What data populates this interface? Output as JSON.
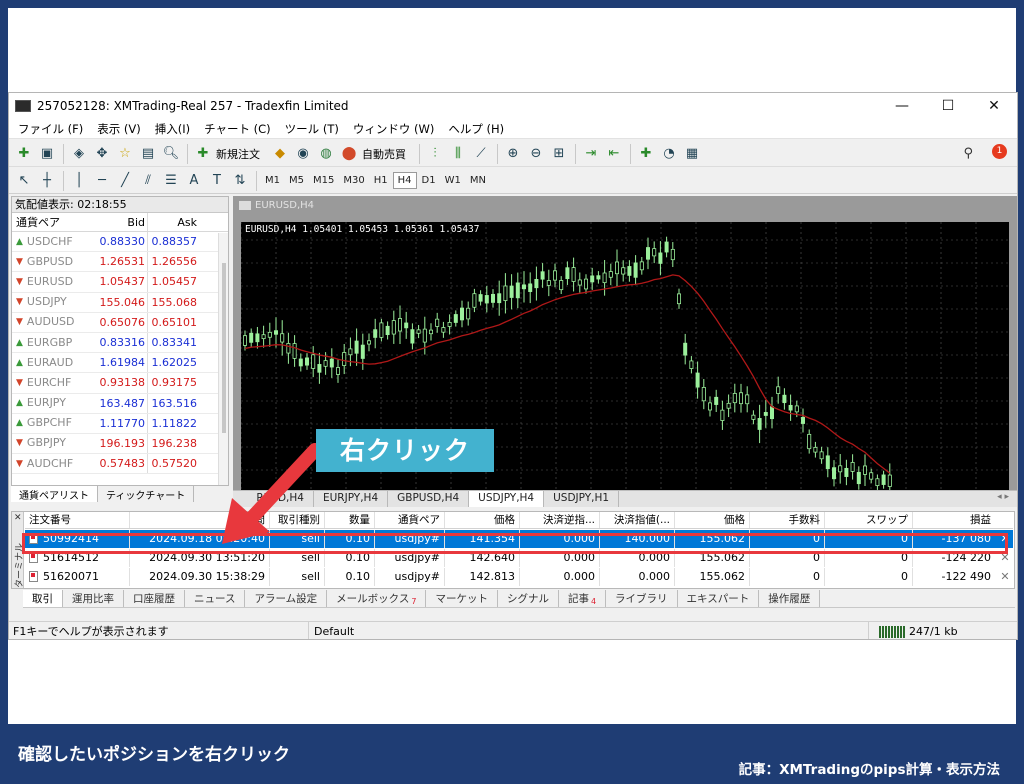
{
  "window": {
    "title": "257052128: XMTrading-Real 257 - Tradexfin Limited",
    "minimize": "—",
    "maximize": "☐",
    "close": "✕"
  },
  "menu": [
    "ファイル (F)",
    "表示 (V)",
    "挿入(I)",
    "チャート (C)",
    "ツール (T)",
    "ウィンドウ (W)",
    "ヘルプ (H)"
  ],
  "toolbar": {
    "new_order": "新規注文",
    "auto_trade": "自動売買",
    "notification_count": "1",
    "timeframes": [
      "M1",
      "M5",
      "M15",
      "M30",
      "H1",
      "H4",
      "D1",
      "W1",
      "MN"
    ],
    "active_timeframe": "H4"
  },
  "market_watch": {
    "header": "気配値表示: 02:18:55",
    "col_symbol": "通貨ペア",
    "col_bid": "Bid",
    "col_ask": "Ask",
    "rows": [
      {
        "symbol": "USDCHF",
        "bid": "0.88330",
        "ask": "0.88357",
        "dir": "up"
      },
      {
        "symbol": "GBPUSD",
        "bid": "1.26531",
        "ask": "1.26556",
        "dir": "down"
      },
      {
        "symbol": "EURUSD",
        "bid": "1.05437",
        "ask": "1.05457",
        "dir": "down"
      },
      {
        "symbol": "USDJPY",
        "bid": "155.046",
        "ask": "155.068",
        "dir": "down"
      },
      {
        "symbol": "AUDUSD",
        "bid": "0.65076",
        "ask": "0.65101",
        "dir": "down"
      },
      {
        "symbol": "EURGBP",
        "bid": "0.83316",
        "ask": "0.83341",
        "dir": "up"
      },
      {
        "symbol": "EURAUD",
        "bid": "1.61984",
        "ask": "1.62025",
        "dir": "up"
      },
      {
        "symbol": "EURCHF",
        "bid": "0.93138",
        "ask": "0.93175",
        "dir": "down"
      },
      {
        "symbol": "EURJPY",
        "bid": "163.487",
        "ask": "163.516",
        "dir": "up"
      },
      {
        "symbol": "GBPCHF",
        "bid": "1.11770",
        "ask": "1.11822",
        "dir": "up"
      },
      {
        "symbol": "GBPJPY",
        "bid": "196.193",
        "ask": "196.238",
        "dir": "down"
      },
      {
        "symbol": "AUDCHF",
        "bid": "0.57483",
        "ask": "0.57520",
        "dir": "down"
      }
    ],
    "tabs": [
      "通貨ペアリスト",
      "ティックチャート"
    ]
  },
  "chart": {
    "window_title": "EURUSD,H4",
    "info": "EURUSD,H4  1.05401 1.05453 1.05361 1.05437",
    "tabs": [
      "EURUSD,H4",
      "EURJPY,H4",
      "GBPUSD,H4",
      "USDJPY,H4",
      "USDJPY,H1"
    ],
    "tab_prefix_hidden": "EU",
    "active_tab": "USDJPY,H4"
  },
  "terminal": {
    "side_label": "ターミナル",
    "headers": [
      "注文番号",
      "時間",
      "取引種別",
      "数量",
      "通貨ペア",
      "価格",
      "決済逆指...",
      "決済指値(...",
      "価格",
      "手数料",
      "スワップ",
      "損益"
    ],
    "rows": [
      {
        "ticket": "50992414",
        "time": "2024.09.18 08:20:40",
        "type": "sell",
        "volume": "0.10",
        "symbol": "usdjpy#",
        "price": "141.354",
        "sl": "0.000",
        "tp": "140.000",
        "current": "155.062",
        "commission": "0",
        "swap": "0",
        "profit": "-137 080",
        "selected": true
      },
      {
        "ticket": "51614512",
        "time": "2024.09.30 13:51:20",
        "type": "sell",
        "volume": "0.10",
        "symbol": "usdjpy#",
        "price": "142.640",
        "sl": "0.000",
        "tp": "0.000",
        "current": "155.062",
        "commission": "0",
        "swap": "0",
        "profit": "-124 220",
        "selected": false
      },
      {
        "ticket": "51620071",
        "time": "2024.09.30 15:38:29",
        "type": "sell",
        "volume": "0.10",
        "symbol": "usdjpy#",
        "price": "142.813",
        "sl": "0.000",
        "tp": "0.000",
        "current": "155.062",
        "commission": "0",
        "swap": "0",
        "profit": "-122 490",
        "selected": false
      }
    ],
    "tabs": [
      {
        "label": "取引",
        "badge": ""
      },
      {
        "label": "運用比率",
        "badge": ""
      },
      {
        "label": "口座履歴",
        "badge": ""
      },
      {
        "label": "ニュース",
        "badge": ""
      },
      {
        "label": "アラーム設定",
        "badge": ""
      },
      {
        "label": "メールボックス",
        "badge": "7"
      },
      {
        "label": "マーケット",
        "badge": ""
      },
      {
        "label": "シグナル",
        "badge": ""
      },
      {
        "label": "記事",
        "badge": "4"
      },
      {
        "label": "ライブラリ",
        "badge": ""
      },
      {
        "label": "エキスパート",
        "badge": ""
      },
      {
        "label": "操作履歴",
        "badge": ""
      }
    ]
  },
  "statusbar": {
    "help": "F1キーでヘルプが表示されます",
    "profile": "Default",
    "connection": "247/1 kb"
  },
  "annotation": {
    "callout": "右クリック",
    "caption": "確認したいポジションを右クリック",
    "credit": "記事：XMTradingのpips計算・表示方法"
  },
  "colors": {
    "background": "#1f3d74",
    "callout": "#43b2cf",
    "highlight": "#e8383d",
    "selection": "#0078d7",
    "candle": "#9cf09c",
    "ma": "#b01818",
    "up_arrow": "#3a9a3a",
    "down_arrow": "#d2442a",
    "bid_blue": "#1a2fd4",
    "bid_red": "#d31a1a"
  }
}
